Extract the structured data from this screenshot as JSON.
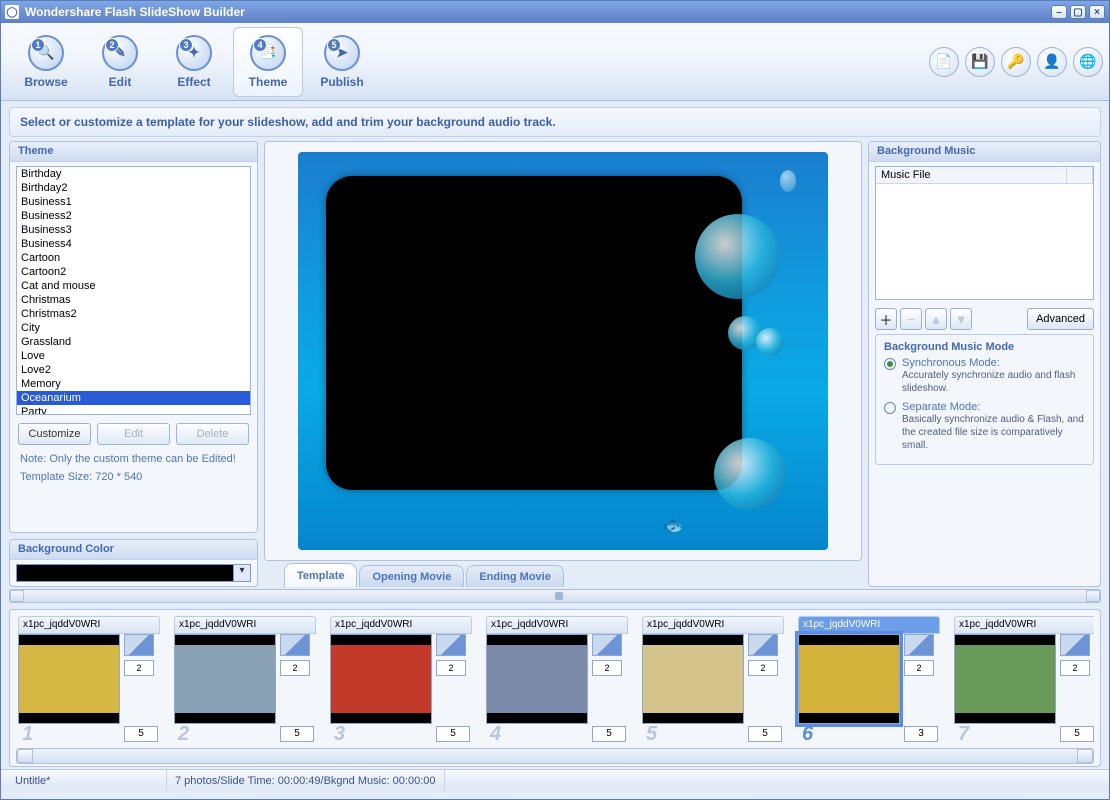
{
  "app_title": "Wondershare Flash SlideShow Builder",
  "window_buttons": {
    "min_tip": "Minimize",
    "max_tip": "Maximize",
    "close_tip": "Close"
  },
  "toolbar": {
    "items": [
      {
        "label": "Browse",
        "num": "1",
        "glyph": "🔍"
      },
      {
        "label": "Edit",
        "num": "2",
        "glyph": "✎"
      },
      {
        "label": "Effect",
        "num": "3",
        "glyph": "✦"
      },
      {
        "label": "Theme",
        "num": "4",
        "glyph": "📑"
      },
      {
        "label": "Publish",
        "num": "5",
        "glyph": "➤"
      }
    ],
    "active_index": 3,
    "right": [
      {
        "name": "doc-icon",
        "glyph": "📄"
      },
      {
        "name": "save-icon",
        "glyph": "💾"
      },
      {
        "name": "key-icon",
        "glyph": "🔑"
      },
      {
        "name": "user-icon",
        "glyph": "👤"
      },
      {
        "name": "globe-icon",
        "glyph": "🌐"
      }
    ]
  },
  "instruction": "Select or customize a template for your slideshow, add and trim your background audio track.",
  "theme": {
    "panel_title": "Theme",
    "items": [
      "Birthday",
      "Birthday2",
      "Business1",
      "Business2",
      "Business3",
      "Business4",
      "Cartoon",
      "Cartoon2",
      "Cat and mouse",
      "Christmas",
      "Christmas2",
      "City",
      "Grassland",
      "Love",
      "Love2",
      "Memory",
      "Oceanarium",
      "Party"
    ],
    "selected": "Oceanarium",
    "customize_label": "Customize",
    "edit_label": "Edit",
    "delete_label": "Delete",
    "note": "Note: Only the custom theme can be Edited!",
    "template_size_label": "Template Size: 720 * 540"
  },
  "bg_color": {
    "panel_title": "Background Color",
    "value": "#000000"
  },
  "preview_tabs": {
    "items": [
      "Template",
      "Opening Movie",
      "Ending Movie"
    ],
    "active_index": 0
  },
  "music": {
    "panel_title": "Background Music",
    "column_header": "Music File",
    "advanced_label": "Advanced",
    "mode_title": "Background Music Mode",
    "modes": [
      {
        "label": "Synchronous Mode:",
        "desc": "Accurately synchronize audio and flash slideshow.",
        "checked": true
      },
      {
        "label": "Separate Mode:",
        "desc": "Basically synchronize audio & Flash, and the created file size is comparatively small.",
        "checked": false
      }
    ]
  },
  "timeline": {
    "clips": [
      {
        "filename": "x1pc_jqddV0WRI",
        "index": "1",
        "seconds": "5",
        "trans_dur": "2",
        "color": "#d5b844"
      },
      {
        "filename": "x1pc_jqddV0WRI",
        "index": "2",
        "seconds": "5",
        "trans_dur": "2",
        "color": "#8aa0b5"
      },
      {
        "filename": "x1pc_jqddV0WRI",
        "index": "3",
        "seconds": "5",
        "trans_dur": "2",
        "color": "#c43a2a"
      },
      {
        "filename": "x1pc_jqddV0WRI",
        "index": "4",
        "seconds": "5",
        "trans_dur": "2",
        "color": "#7a8aa8"
      },
      {
        "filename": "x1pc_jqddV0WRI",
        "index": "5",
        "seconds": "5",
        "trans_dur": "2",
        "color": "#d4c38a"
      },
      {
        "filename": "x1pc_jqddV0WRI",
        "index": "6",
        "seconds": "3",
        "trans_dur": "2",
        "color": "#d2b23a"
      },
      {
        "filename": "x1pc_jqddV0WRI",
        "index": "7",
        "seconds": "5",
        "trans_dur": "2",
        "color": "#6a9a5a"
      }
    ],
    "selected_index": 5
  },
  "status": {
    "doc": "Untitle*",
    "info": "7 photos/Slide Time: 00:00:49/Bkgnd Music: 00:00:00"
  }
}
